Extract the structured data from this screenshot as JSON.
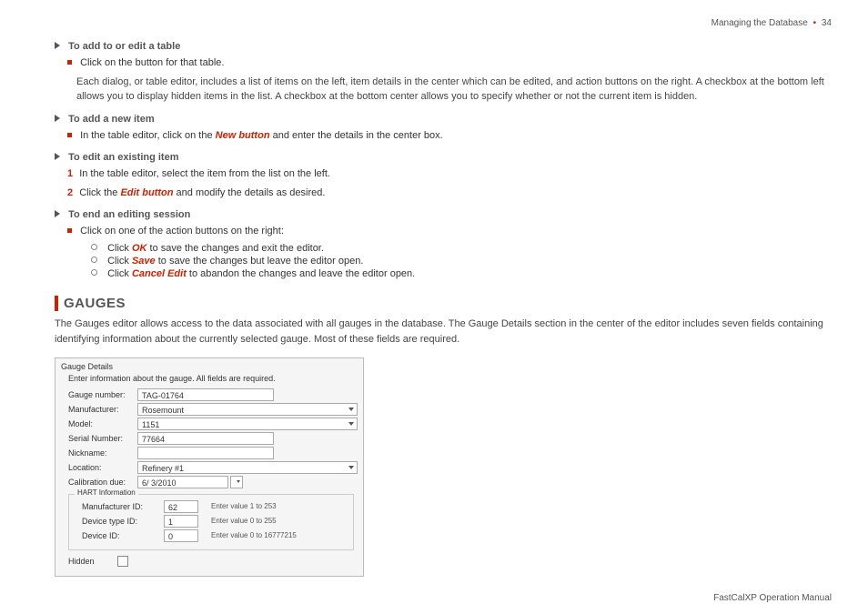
{
  "header": {
    "chapter": "Managing the Database",
    "page": "34"
  },
  "footer": "FastCalXP Operation Manual",
  "sections": {
    "s1": {
      "title": "To add to or edit a table",
      "b1": "Click on the button for that table.",
      "para": "Each dialog, or table editor, includes a list of items on the left, item details in the center which can be edited, and action buttons on the right. A checkbox at the bottom left allows you to display hidden items in the list. A checkbox at the bottom center allows you to specify whether or not the current item is hidden."
    },
    "s2": {
      "title": "To add a new item",
      "b1_pre": "In the table editor, click on the ",
      "b1_em": "New button",
      "b1_post": " and enter the details in the center box."
    },
    "s3": {
      "title": "To edit an existing item",
      "l1": "In the table editor, select the item from the list on the left.",
      "l2_pre": "Click the ",
      "l2_em": "Edit button",
      "l2_post": " and modify the details as desired."
    },
    "s4": {
      "title": "To end an editing session",
      "b1": "Click on one of the action buttons on the right:",
      "ok_pre": "Click ",
      "ok_em": "OK",
      "ok_post": " to save the changes and exit the editor.",
      "save_pre": "Click ",
      "save_em": "Save",
      "save_post": " to save the changes but leave the editor open.",
      "cancel_pre": "Click ",
      "cancel_em": "Cancel Edit",
      "cancel_post": " to abandon the changes and leave the editor open."
    },
    "gauges": {
      "title": "GAUGES",
      "para": "The Gauges editor allows access to the data associated with all gauges in the database. The Gauge Details section in the center of the editor includes seven fields containing identifying information about the currently selected gauge. Most of these fields are required."
    }
  },
  "panel": {
    "title": "Gauge Details",
    "subtitle": "Enter information about the gauge. All fields are required.",
    "labels": {
      "gaugeNumber": "Gauge number:",
      "manufacturer": "Manufacturer:",
      "model": "Model:",
      "serialNumber": "Serial Number:",
      "nickname": "Nickname:",
      "location": "Location:",
      "calDue": "Calibration due:",
      "hart": "HART Information",
      "mfgId": "Manufacturer ID:",
      "devType": "Device type ID:",
      "devId": "Device ID:",
      "hidden": "Hidden"
    },
    "values": {
      "gaugeNumber": "TAG-01764",
      "manufacturer": "Rosemount",
      "model": "1151",
      "serialNumber": "77664",
      "nickname": "",
      "location": "Refinery #1",
      "calDue": "6/ 3/2010",
      "mfgId": "62",
      "devType": "1",
      "devId": "0"
    },
    "hints": {
      "mfgId": "Enter value 1 to 253",
      "devType": "Enter value 0 to 255",
      "devId": "Enter value 0 to 16777215"
    }
  },
  "nums": {
    "n1": "1",
    "n2": "2"
  }
}
